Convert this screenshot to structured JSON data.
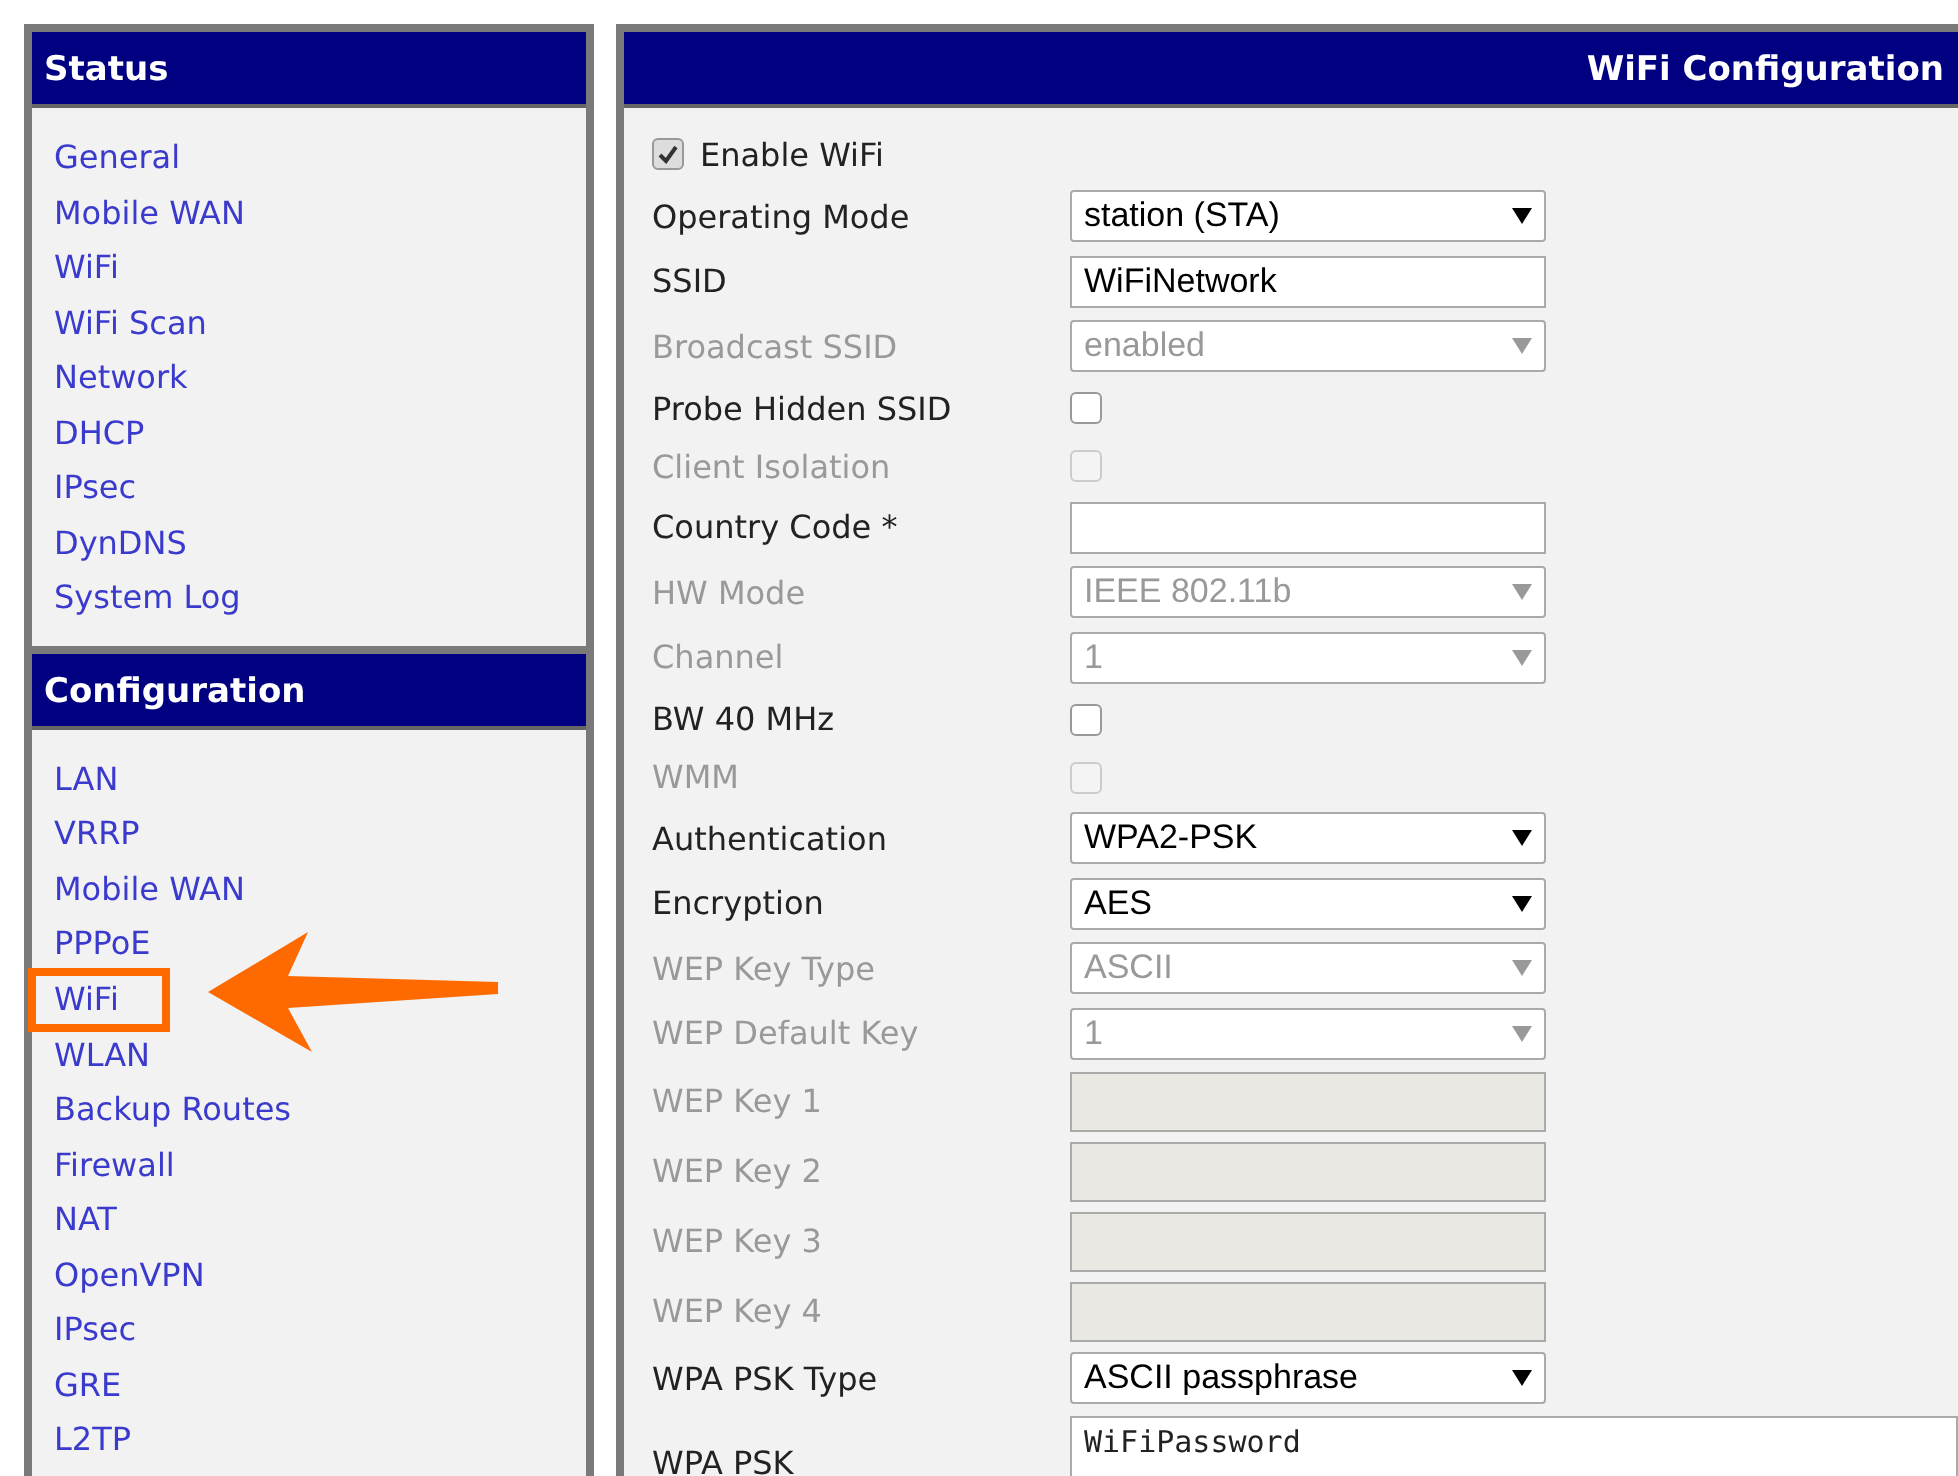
{
  "sidebar": {
    "sections": [
      {
        "title": "Status",
        "items": [
          {
            "label": "General",
            "highlighted": false
          },
          {
            "label": "Mobile WAN",
            "highlighted": false
          },
          {
            "label": "WiFi",
            "highlighted": false
          },
          {
            "label": "WiFi Scan",
            "highlighted": false
          },
          {
            "label": "Network",
            "highlighted": false
          },
          {
            "label": "DHCP",
            "highlighted": false
          },
          {
            "label": "IPsec",
            "highlighted": false
          },
          {
            "label": "DynDNS",
            "highlighted": false
          },
          {
            "label": "System Log",
            "highlighted": false
          }
        ]
      },
      {
        "title": "Configuration",
        "items": [
          {
            "label": "LAN",
            "highlighted": false
          },
          {
            "label": "VRRP",
            "highlighted": false
          },
          {
            "label": "Mobile WAN",
            "highlighted": false
          },
          {
            "label": "PPPoE",
            "highlighted": false
          },
          {
            "label": "WiFi",
            "highlighted": true
          },
          {
            "label": "WLAN",
            "highlighted": false
          },
          {
            "label": "Backup Routes",
            "highlighted": false
          },
          {
            "label": "Firewall",
            "highlighted": false
          },
          {
            "label": "NAT",
            "highlighted": false
          },
          {
            "label": "OpenVPN",
            "highlighted": false
          },
          {
            "label": "IPsec",
            "highlighted": false
          },
          {
            "label": "GRE",
            "highlighted": false
          },
          {
            "label": "L2TP",
            "highlighted": false
          }
        ]
      }
    ]
  },
  "form": {
    "title": "WiFi Configuration",
    "fields": [
      {
        "kind": "toggle",
        "label": "Enable WiFi",
        "checked": true,
        "disabled": false
      },
      {
        "kind": "select",
        "label": "Operating Mode",
        "value": "station (STA)",
        "disabled": false
      },
      {
        "kind": "text",
        "label": "SSID",
        "value": "WiFiNetwork",
        "disabled": false
      },
      {
        "kind": "select",
        "label": "Broadcast SSID",
        "value": "enabled",
        "disabled": true
      },
      {
        "kind": "checkbox",
        "label": "Probe Hidden SSID",
        "checked": false,
        "disabled": false
      },
      {
        "kind": "checkbox",
        "label": "Client Isolation",
        "checked": false,
        "disabled": true
      },
      {
        "kind": "text",
        "label": "Country Code *",
        "disabled": false
      },
      {
        "kind": "select",
        "label": "HW Mode",
        "value": "IEEE 802.11b",
        "disabled": true
      },
      {
        "kind": "select",
        "label": "Channel",
        "value": "1",
        "disabled": true
      },
      {
        "kind": "checkbox",
        "label": "BW 40 MHz",
        "checked": false,
        "disabled": false
      },
      {
        "kind": "checkbox",
        "label": "WMM",
        "checked": false,
        "disabled": true
      },
      {
        "kind": "select",
        "label": "Authentication",
        "value": "WPA2-PSK",
        "disabled": false
      },
      {
        "kind": "select",
        "label": "Encryption",
        "value": "AES",
        "disabled": false
      },
      {
        "kind": "select",
        "label": "WEP Key Type",
        "value": "ASCII",
        "disabled": true
      },
      {
        "kind": "select",
        "label": "WEP Default Key",
        "value": "1",
        "disabled": true
      },
      {
        "kind": "text",
        "label": "WEP Key 1",
        "disabled": true
      },
      {
        "kind": "text",
        "label": "WEP Key 2",
        "disabled": true
      },
      {
        "kind": "text",
        "label": "WEP Key 3",
        "disabled": true
      },
      {
        "kind": "text",
        "label": "WEP Key 4",
        "disabled": true
      },
      {
        "kind": "select",
        "label": "WPA PSK Type",
        "value": "ASCII passphrase",
        "disabled": false
      },
      {
        "kind": "textarea",
        "label": "WPA PSK",
        "value": "WiFiPassword",
        "disabled": false
      }
    ]
  }
}
